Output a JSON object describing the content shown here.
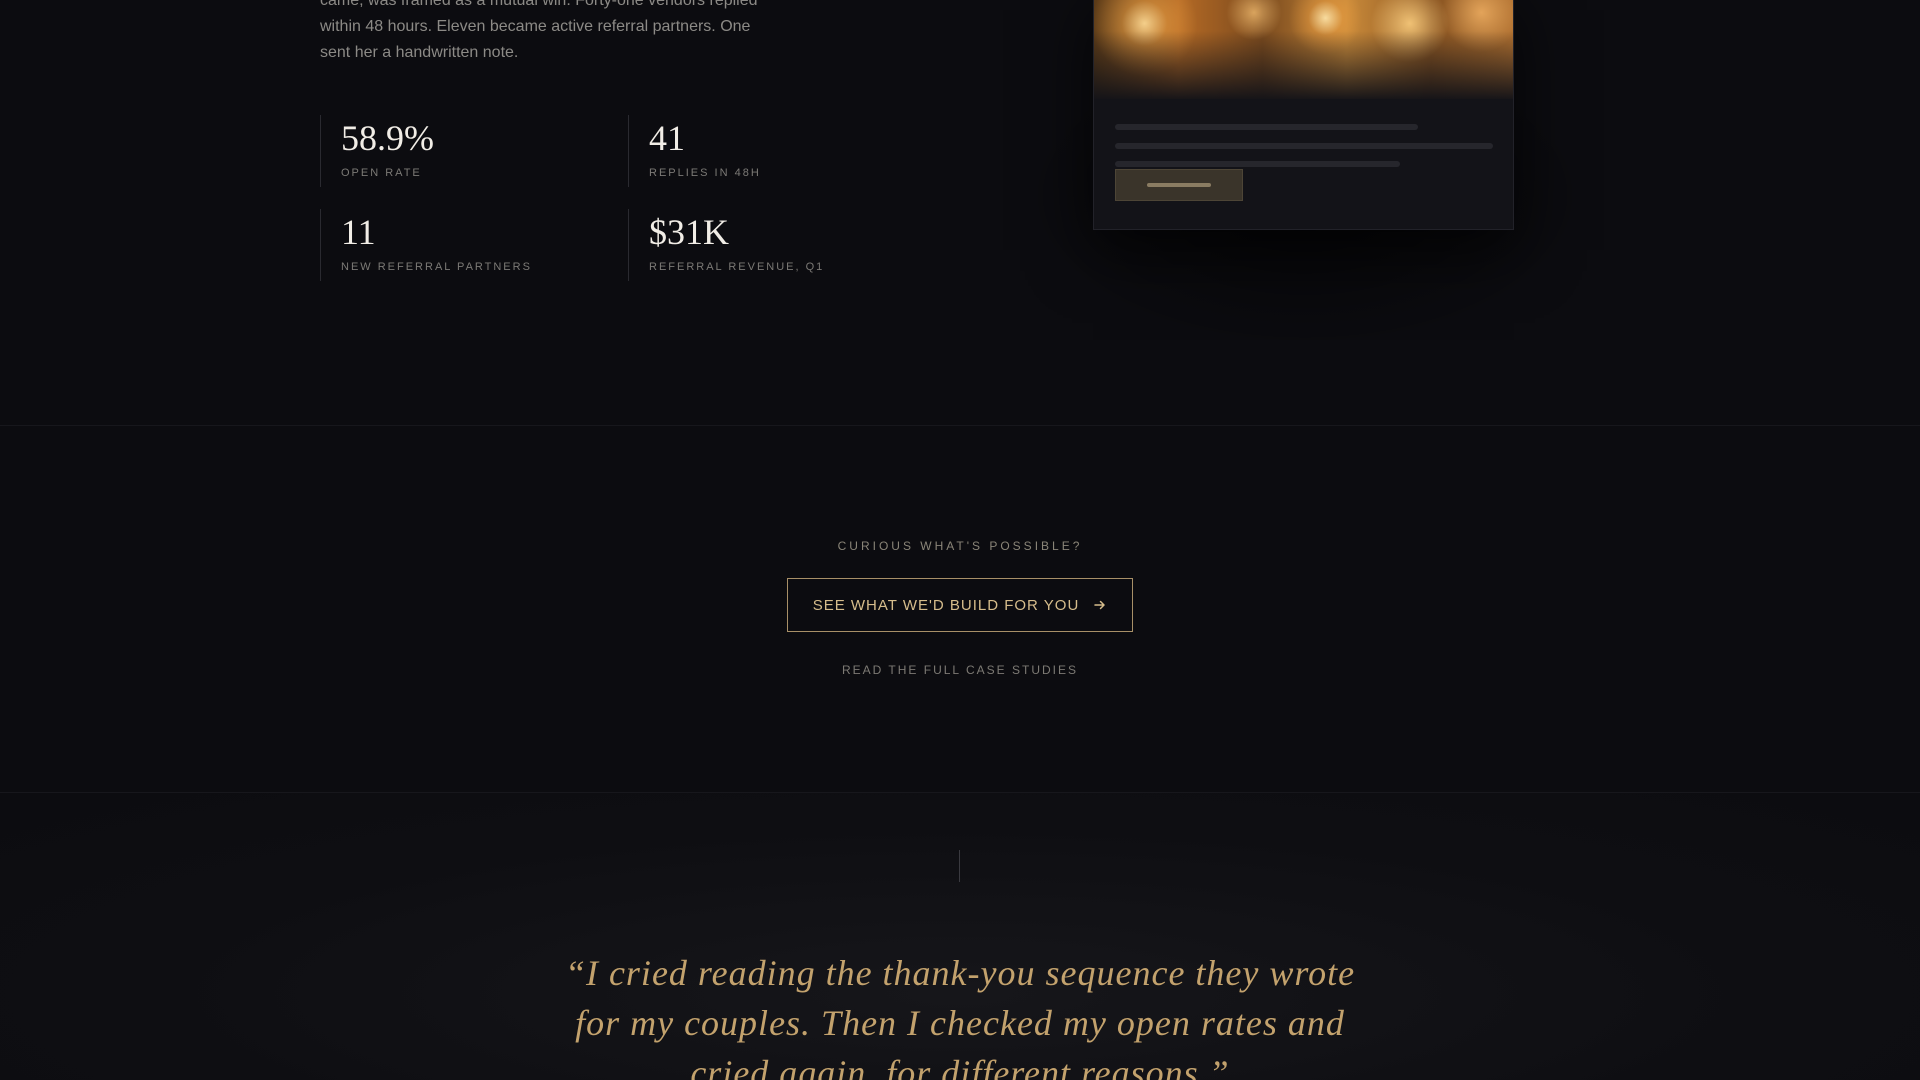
{
  "case_study": {
    "body": "came, was framed as a mutual win. Forty-one vendors replied within 48 hours. Eleven became active referral partners. One sent her a handwritten note.",
    "stats": [
      {
        "value": "58.9%",
        "label": "OPEN RATE"
      },
      {
        "value": "41",
        "label": "REPLIES IN 48H"
      },
      {
        "value": "11",
        "label": "NEW REFERRAL PARTNERS"
      },
      {
        "value": "$31K",
        "label": "REFERRAL REVENUE, Q1"
      }
    ]
  },
  "cta": {
    "eyebrow": "CURIOUS WHAT'S POSSIBLE?",
    "button_label": "SEE WHAT WE'D BUILD FOR YOU",
    "button_icon": "arrow-right-icon",
    "secondary_link": "READ THE FULL CASE STUDIES"
  },
  "testimonial": {
    "quote": "“I cried reading the thank-you sequence they wrote for my couples. Then I checked my open rates and cried again, for different reasons.”"
  },
  "colors": {
    "background": "#0c0c10",
    "accent_gold": "#c3a26d",
    "button_border": "#a89068"
  }
}
